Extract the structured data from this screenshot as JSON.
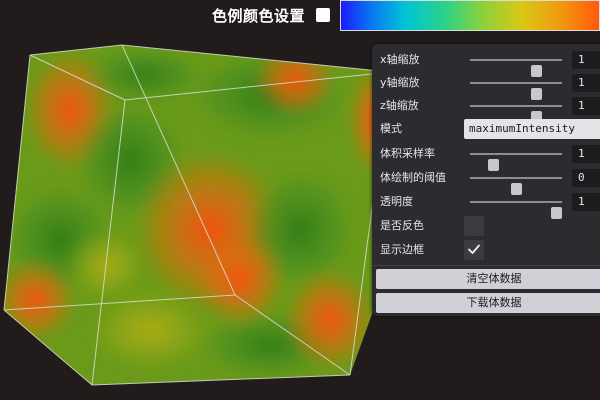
{
  "topbar": {
    "colormap_label": "色例颜色设置",
    "colormap_checked": false
  },
  "volume": {
    "colors": {
      "green": "#3f8a1e",
      "yellow_green": "#7aa818",
      "orange": "#e0620e",
      "red": "#e24408",
      "edge": "#cfd6c8"
    }
  },
  "panel": {
    "x_scale": {
      "label": "x轴缩放",
      "value": "1",
      "level": 0.75
    },
    "y_scale": {
      "label": "y轴缩放",
      "value": "1",
      "level": 0.75
    },
    "z_scale": {
      "label": "z轴缩放",
      "value": "1",
      "level": 0.75
    },
    "mode": {
      "label": "模式",
      "value": "maximumIntensity"
    },
    "sample_rate": {
      "label": "体积采样率",
      "value": "1",
      "level": 0.22
    },
    "threshold": {
      "label": "体绘制的阈值",
      "value": "0",
      "level": 0.5
    },
    "opacity": {
      "label": "透明度",
      "value": "1",
      "level": 1.0
    },
    "invert_color": {
      "label": "是否反色",
      "checked": false
    },
    "show_border": {
      "label": "显示边框",
      "checked": true
    },
    "clear_button": "清空体数据",
    "download_button": "下载体数据"
  }
}
